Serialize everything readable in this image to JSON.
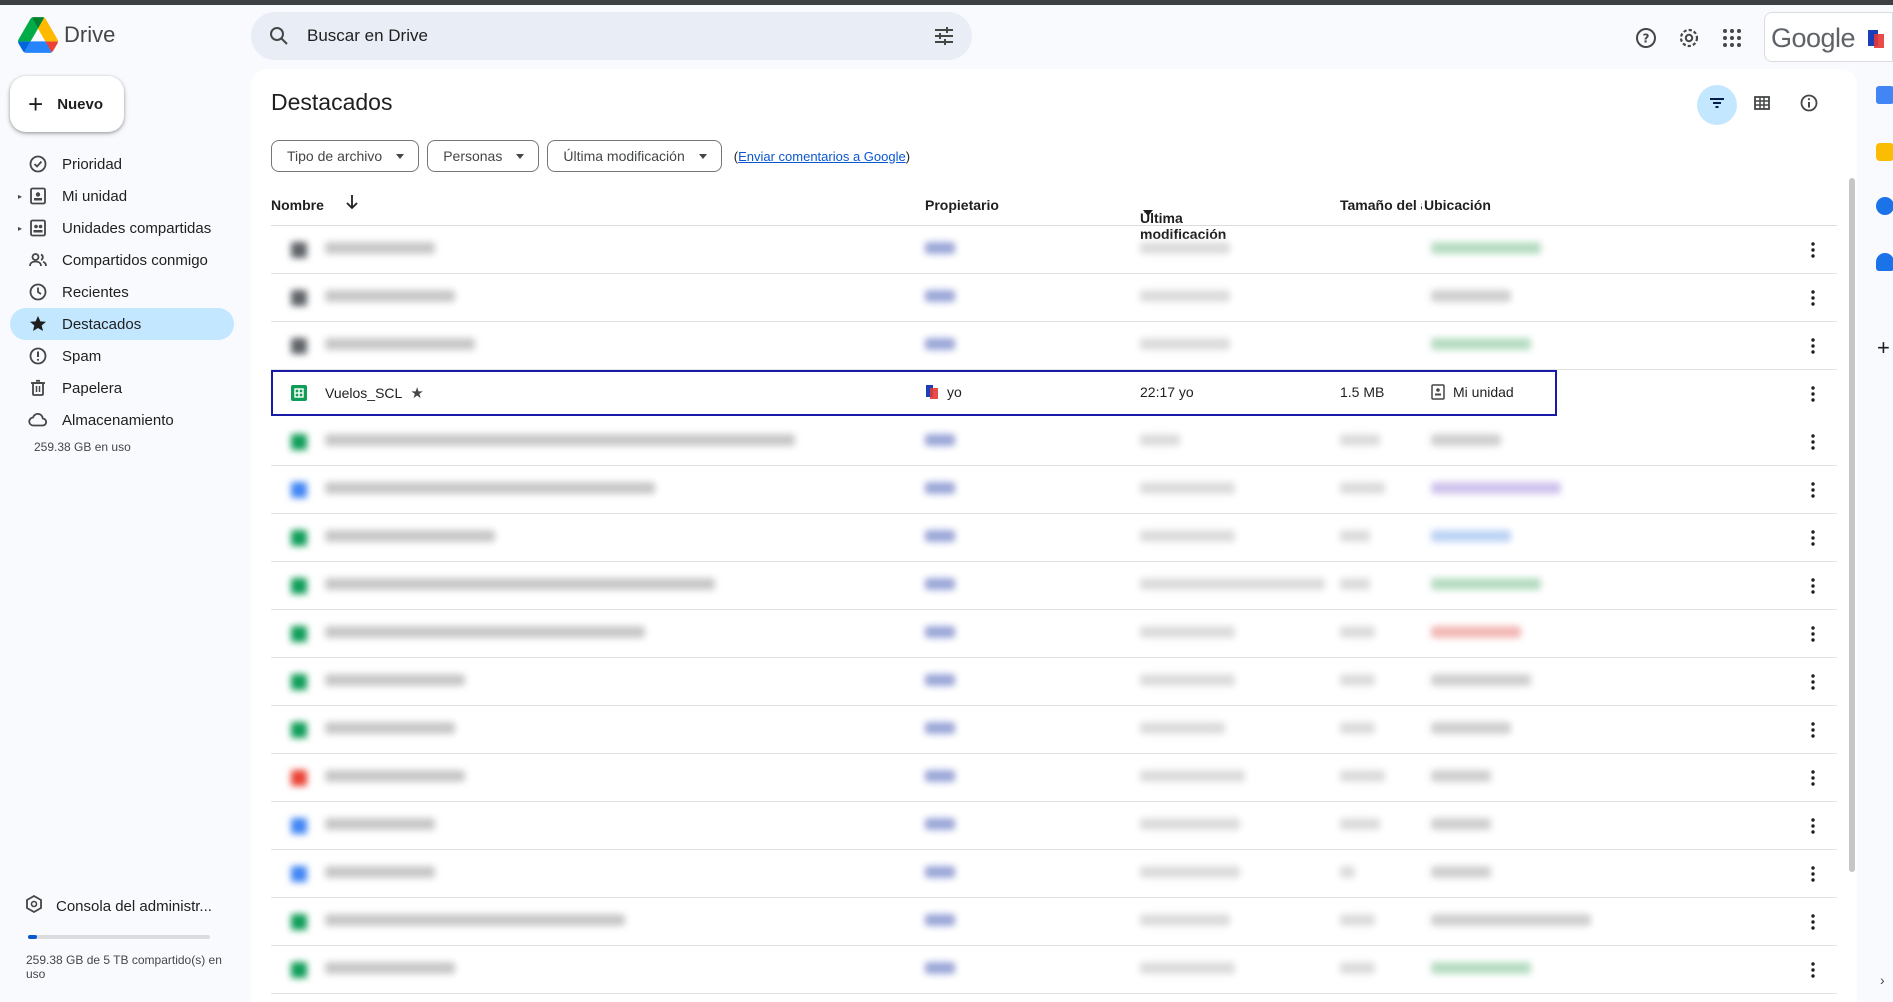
{
  "app": {
    "name": "Drive"
  },
  "search": {
    "placeholder": "Buscar en Drive"
  },
  "account": {
    "brand": "Google"
  },
  "sidebar": {
    "new_label": "Nuevo",
    "items": [
      {
        "label": "Prioridad",
        "icon": "check-circle-icon"
      },
      {
        "label": "Mi unidad",
        "icon": "my-drive-icon"
      },
      {
        "label": "Unidades compartidas",
        "icon": "shared-drives-icon"
      },
      {
        "label": "Compartidos conmigo",
        "icon": "people-icon"
      },
      {
        "label": "Recientes",
        "icon": "clock-icon"
      },
      {
        "label": "Destacados",
        "icon": "star-icon"
      },
      {
        "label": "Spam",
        "icon": "spam-icon"
      },
      {
        "label": "Papelera",
        "icon": "trash-icon"
      },
      {
        "label": "Almacenamiento",
        "icon": "cloud-icon"
      }
    ],
    "storage_used": "259.38 GB en uso",
    "console_label": "Consola del administr...",
    "storage_quota_text": "259.38 GB de 5 TB compartido(s) en uso",
    "storage_fraction": 0.05
  },
  "main": {
    "title": "Destacados",
    "filters": [
      "Tipo de archivo",
      "Personas",
      "Última modificación"
    ],
    "feedback": {
      "open": "(",
      "link": "Enviar comentarios a Google",
      "close": ")"
    },
    "columns": {
      "name": "Nombre",
      "owner": "Propietario",
      "modified": "Última modificación",
      "size": "Tamaño del a",
      "location": "Ubicación"
    },
    "selected_row": {
      "name": "Vuelos_SCL",
      "owner": "yo",
      "modified": "22:17 yo",
      "size": "1.5 MB",
      "location": "Mi unidad"
    }
  },
  "colors": {
    "accent": "#0b57d0",
    "active_nav": "#c2e7ff",
    "sheets_green": "#0f9d58",
    "selection_outline": "#1a1aa8"
  }
}
